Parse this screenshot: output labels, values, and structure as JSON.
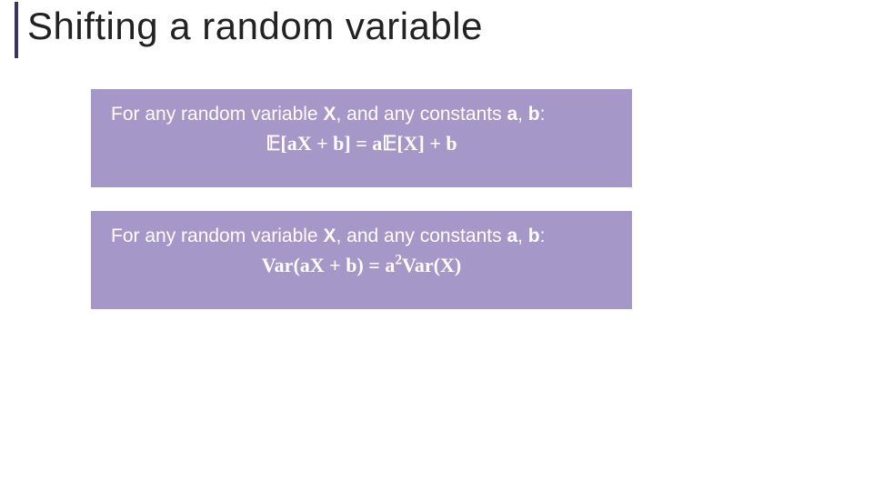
{
  "title": "Shifting a random variable",
  "box1": {
    "lead_prefix": "For any random variable ",
    "var": "X",
    "lead_mid": ", and any constants ",
    "a": "a",
    "comma": ", ",
    "b": "b",
    "lead_suffix": ":",
    "formula_lhs_E": "𝔼",
    "formula_lhs_open": "[",
    "formula_lhs_inner": "aX + b",
    "formula_lhs_close": "]",
    "formula_eq": " = ",
    "formula_rhs_a": "a",
    "formula_rhs_E": "𝔼",
    "formula_rhs_open": "[",
    "formula_rhs_X": "X",
    "formula_rhs_close": "]",
    "formula_rhs_plus_b": " + b"
  },
  "box2": {
    "lead_prefix": "For any random variable ",
    "var": "X",
    "lead_mid": ", and any constants ",
    "a": "a",
    "comma": ", ",
    "b": "b",
    "lead_suffix": ":",
    "formula_var1": "Var",
    "formula_open1": "(",
    "formula_inner1": "aX + b",
    "formula_close1": ")",
    "formula_eq": " = ",
    "formula_a": "a",
    "formula_exp": "2",
    "formula_var2": "Var",
    "formula_open2": "(",
    "formula_X": "X",
    "formula_close2": ")"
  }
}
